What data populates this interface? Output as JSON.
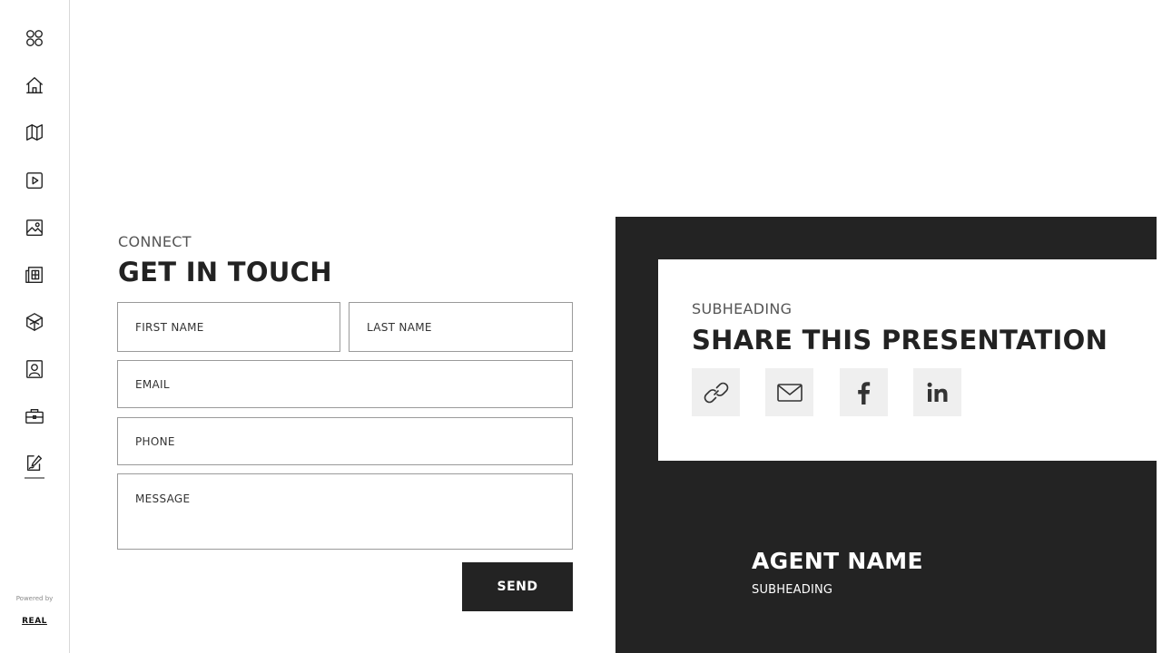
{
  "sidebar": {
    "items": [
      {
        "icon": "grid-icon"
      },
      {
        "icon": "home-icon"
      },
      {
        "icon": "map-icon"
      },
      {
        "icon": "play-icon"
      },
      {
        "icon": "image-icon"
      },
      {
        "icon": "newspaper-icon"
      },
      {
        "icon": "cube-icon"
      },
      {
        "icon": "contact-card-icon"
      },
      {
        "icon": "briefcase-icon"
      },
      {
        "icon": "edit-icon",
        "active": true
      }
    ],
    "powered_by": "Powered by",
    "brand": "REAL"
  },
  "contact": {
    "eyebrow": "CONNECT",
    "title": "GET IN TOUCH",
    "first_name_placeholder": "FIRST NAME",
    "last_name_placeholder": "LAST NAME",
    "email_placeholder": "EMAIL",
    "phone_placeholder": "PHONE",
    "message_placeholder": "MESSAGE",
    "send_label": "SEND"
  },
  "share": {
    "eyebrow": "SUBHEADING",
    "title": "SHARE THIS PRESENTATION",
    "buttons": [
      {
        "icon": "link-icon"
      },
      {
        "icon": "mail-icon"
      },
      {
        "icon": "facebook-icon"
      },
      {
        "icon": "linkedin-icon"
      }
    ]
  },
  "agent": {
    "name": "AGENT NAME",
    "subheading": "SUBHEADING"
  },
  "colors": {
    "dark": "#232323",
    "share_button_bg": "#efefef",
    "text": "#222222"
  }
}
